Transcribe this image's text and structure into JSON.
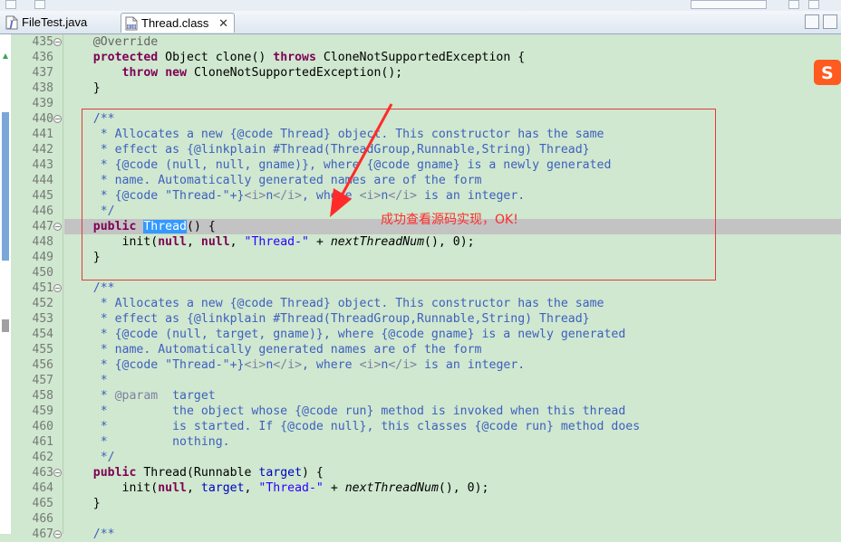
{
  "tabs": [
    {
      "label": "FileTest.java",
      "icon": "java-file-icon",
      "active": false
    },
    {
      "label": "Thread.class",
      "icon": "class-file-icon",
      "active": true,
      "close": "✕"
    }
  ],
  "annotation_text": "成功查看源码实现，OK!",
  "ime_badge": "S",
  "colors": {
    "editor_bg": "#cfe8cf",
    "keyword": "#7f0055",
    "comment": "#3f5fbf",
    "string": "#2a00ff",
    "annotation_box": "#e23b3b"
  },
  "code": {
    "lines": [
      {
        "num": "435",
        "fold": "−",
        "html": "    <span class='ann'>@Override</span>"
      },
      {
        "num": "436",
        "html": "    <span class='kw'>protected</span> Object clone() <span class='kw'>throws</span> CloneNotSupportedException {"
      },
      {
        "num": "437",
        "html": "        <span class='kw'>throw</span> <span class='kw'>new</span> CloneNotSupportedException();"
      },
      {
        "num": "438",
        "html": "    }"
      },
      {
        "num": "439",
        "html": ""
      },
      {
        "num": "440",
        "fold": "−",
        "html": "    <span class='cm'>/**</span>"
      },
      {
        "num": "441",
        "html": "<span class='cm'>     * Allocates a new {@code Thread} object. This constructor has the same</span>"
      },
      {
        "num": "442",
        "html": "<span class='cm'>     * effect as {@linkplain #Thread(ThreadGroup,Runnable,String) Thread}</span>"
      },
      {
        "num": "443",
        "html": "<span class='cm'>     * {@code (null, null, gname)}, where {@code gname} is a newly generated</span>"
      },
      {
        "num": "444",
        "html": "<span class='cm'>     * name. Automatically generated names are of the form</span>"
      },
      {
        "num": "445",
        "html": "<span class='cm'>     * {@code \"Thread-\"+}</span><span class='tg'>&lt;i&gt;</span><span class='cm'>n</span><span class='tg'>&lt;/i&gt;</span><span class='cm'>, where </span><span class='tg'>&lt;i&gt;</span><span class='cm'>n</span><span class='tg'>&lt;/i&gt;</span><span class='cm'> is an integer.</span>"
      },
      {
        "num": "446",
        "html": "<span class='cm'>     */</span>"
      },
      {
        "num": "447",
        "fold": "−",
        "highlight": true,
        "html": "    <span class='kw'>public</span> <span class='sel'>Thread</span>() {"
      },
      {
        "num": "448",
        "html": "        init(<span class='kw'>null</span>, <span class='kw'>null</span>, <span class='str'>\"Thread-\"</span> + <span class='it'>nextThreadNum</span>(), 0);"
      },
      {
        "num": "449",
        "html": "    }"
      },
      {
        "num": "450",
        "html": ""
      },
      {
        "num": "451",
        "fold": "−",
        "html": "    <span class='cm'>/**</span>"
      },
      {
        "num": "452",
        "html": "<span class='cm'>     * Allocates a new {@code Thread} object. This constructor has the same</span>"
      },
      {
        "num": "453",
        "html": "<span class='cm'>     * effect as {@linkplain #Thread(ThreadGroup,Runnable,String) Thread}</span>"
      },
      {
        "num": "454",
        "html": "<span class='cm'>     * {@code (null, target, gname)}, where {@code gname} is a newly generated</span>"
      },
      {
        "num": "455",
        "html": "<span class='cm'>     * name. Automatically generated names are of the form</span>"
      },
      {
        "num": "456",
        "html": "<span class='cm'>     * {@code \"Thread-\"+}</span><span class='tg'>&lt;i&gt;</span><span class='cm'>n</span><span class='tg'>&lt;/i&gt;</span><span class='cm'>, where </span><span class='tg'>&lt;i&gt;</span><span class='cm'>n</span><span class='tg'>&lt;/i&gt;</span><span class='cm'> is an integer.</span>"
      },
      {
        "num": "457",
        "html": "<span class='cm'>     *</span>"
      },
      {
        "num": "458",
        "html": "<span class='cm'>     * </span><span class='tg'>@param</span><span class='cm'>  target</span>"
      },
      {
        "num": "459",
        "html": "<span class='cm'>     *         the object whose {@code run} method is invoked when this thread</span>"
      },
      {
        "num": "460",
        "html": "<span class='cm'>     *         is started. If {@code null}, this classes {@code run} method does</span>"
      },
      {
        "num": "461",
        "html": "<span class='cm'>     *         nothing.</span>"
      },
      {
        "num": "462",
        "html": "<span class='cm'>     */</span>"
      },
      {
        "num": "463",
        "fold": "−",
        "html": "    <span class='kw'>public</span> Thread(Runnable <span class='fld'>target</span>) {"
      },
      {
        "num": "464",
        "html": "        init(<span class='kw'>null</span>, <span class='fld'>target</span>, <span class='str'>\"Thread-\"</span> + <span class='it'>nextThreadNum</span>(), 0);"
      },
      {
        "num": "465",
        "html": "    }"
      },
      {
        "num": "466",
        "html": ""
      },
      {
        "num": "467",
        "fold": "−",
        "html": "    <span class='cm'>/**</span>"
      }
    ]
  }
}
